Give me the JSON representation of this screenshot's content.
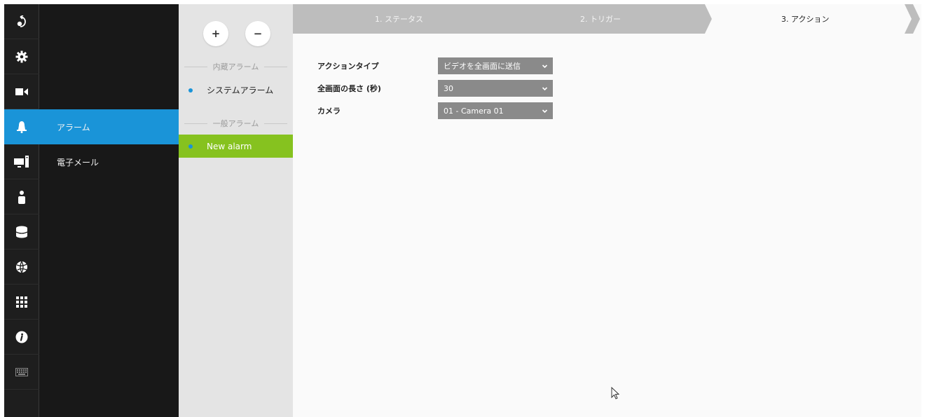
{
  "rail": {
    "items": [
      {
        "icon": "logout-icon"
      },
      {
        "icon": "gear-icon"
      },
      {
        "icon": "camera-icon"
      },
      {
        "icon": "bell-icon",
        "active": true
      },
      {
        "icon": "monitor-icon"
      },
      {
        "icon": "user-icon"
      },
      {
        "icon": "database-icon"
      },
      {
        "icon": "globe-icon"
      },
      {
        "icon": "grid-icon"
      },
      {
        "icon": "info-icon"
      },
      {
        "icon": "keyboard-icon"
      }
    ],
    "active_color": "#1a94d8"
  },
  "subnav": {
    "items": [
      {
        "label": "アラーム",
        "active": true
      },
      {
        "label": "電子メール"
      }
    ]
  },
  "alarm_panel": {
    "add_label": "+",
    "remove_label": "−",
    "builtin_section": "内蔵アラーム",
    "builtin_items": [
      {
        "label": "システムアラーム"
      }
    ],
    "general_section": "一般アラーム",
    "general_items": [
      {
        "label": "New alarm",
        "selected": true
      }
    ],
    "selected_color": "#86c21f"
  },
  "steps": [
    {
      "label": "1. ステータス"
    },
    {
      "label": "2. トリガー"
    },
    {
      "label": "3. アクション",
      "active": true
    }
  ],
  "form": {
    "action_type": {
      "label": "アクションタイプ",
      "value": "ビデオを全画面に送信"
    },
    "fullscreen_length": {
      "label": "全画面の長さ (秒)",
      "value": "30"
    },
    "camera": {
      "label": "カメラ",
      "value": "01 - Camera 01"
    }
  }
}
